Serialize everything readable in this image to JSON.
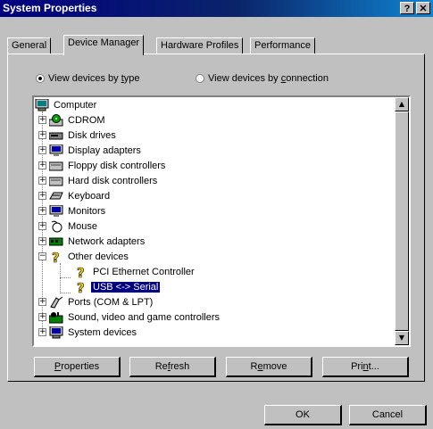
{
  "window": {
    "title": "System Properties",
    "help_label": "?",
    "close_label": "✕"
  },
  "tabs": [
    {
      "label": "General"
    },
    {
      "label": "Device Manager",
      "active": true
    },
    {
      "label": "Hardware Profiles"
    },
    {
      "label": "Performance"
    }
  ],
  "view_options": {
    "by_type": {
      "pre": "View devices by ",
      "key": "t",
      "post": "ype",
      "selected": true
    },
    "by_connection": {
      "pre": "View devices by ",
      "key": "c",
      "post": "onnection",
      "selected": false
    }
  },
  "tree": {
    "root": "Computer",
    "items": [
      {
        "label": "CDROM",
        "expander": "+",
        "icon": "cdrom-icon"
      },
      {
        "label": "Disk drives",
        "expander": "+",
        "icon": "disk-drive-icon"
      },
      {
        "label": "Display adapters",
        "expander": "+",
        "icon": "monitor-icon"
      },
      {
        "label": "Floppy disk controllers",
        "expander": "+",
        "icon": "controller-icon"
      },
      {
        "label": "Hard disk controllers",
        "expander": "+",
        "icon": "controller-icon"
      },
      {
        "label": "Keyboard",
        "expander": "+",
        "icon": "keyboard-icon"
      },
      {
        "label": "Monitors",
        "expander": "+",
        "icon": "monitor-icon"
      },
      {
        "label": "Mouse",
        "expander": "+",
        "icon": "mouse-icon"
      },
      {
        "label": "Network adapters",
        "expander": "+",
        "icon": "network-card-icon"
      },
      {
        "label": "Other devices",
        "expander": "−",
        "icon": "unknown-device-icon"
      },
      {
        "label": "PCI Ethernet Controller",
        "child": true,
        "icon": "unknown-device-icon"
      },
      {
        "label": "USB <-> Serial",
        "child": true,
        "icon": "unknown-device-icon",
        "selected": true
      },
      {
        "label": "Ports (COM & LPT)",
        "expander": "+",
        "icon": "port-icon"
      },
      {
        "label": "Sound, video and game controllers",
        "expander": "+",
        "icon": "sound-icon"
      },
      {
        "label": "System devices",
        "expander": "+",
        "icon": "computer-icon"
      }
    ]
  },
  "actions": {
    "properties": {
      "pre": "",
      "key": "P",
      "post": "roperties"
    },
    "refresh": {
      "pre": "Re",
      "key": "f",
      "post": "resh"
    },
    "remove": {
      "pre": "R",
      "key": "e",
      "post": "move"
    },
    "print": {
      "pre": "Pri",
      "key": "n",
      "post": "t..."
    }
  },
  "dialog": {
    "ok_label": "OK",
    "cancel_label": "Cancel"
  },
  "colors": {
    "title_start": "#000080",
    "title_end": "#1084d0",
    "face": "#c0c0c0",
    "selection": "#000080",
    "unknown_icon": "#ffd800"
  }
}
